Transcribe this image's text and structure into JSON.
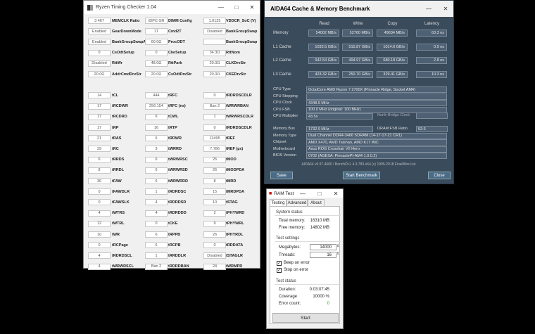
{
  "rtc": {
    "title": "Ryzen Timing Checker 1.04",
    "rows": [
      [
        "3 467",
        "MEMCLK Ratio",
        "tDPC-SR",
        "DIMM Config",
        "1.0125",
        "VDDCR_SoC (V)"
      ],
      [
        "Enabled",
        "GearDownMode",
        "1T",
        "Cmd2T",
        "Disabled",
        "BankGroupSwap"
      ],
      [
        "Enabled",
        "BankGroupSwapAlt",
        "60.0Ω",
        "ProcODT",
        "",
        "BankGroupSwap"
      ],
      [
        "0",
        "CsOdtSetup",
        "0",
        "CkeSetup",
        "34.3Ω",
        "RttNom"
      ],
      [
        "Disabled",
        "RttWr",
        "48.0Ω",
        "RttPark",
        "20.0Ω",
        "CLKDrvStr"
      ],
      [
        "20.0Ω",
        "AddrCmdDrvStr",
        "20.0Ω",
        "CsOdtDrvStr",
        "20.0Ω",
        "CKEDrvStr"
      ],
      [
        "",
        "",
        "",
        "",
        "",
        ""
      ],
      [
        "14",
        "tCL",
        "444",
        "tRFC",
        "0",
        "tRDRDSCDLR"
      ],
      [
        "17",
        "tRCDWR",
        "256.154",
        "tRFC (ns)",
        "Ban 2",
        "tWRWRBAN"
      ],
      [
        "17",
        "tRCDRD",
        "6",
        "tCWL",
        "1",
        "tWRWRSCDLR"
      ],
      [
        "17",
        "tRP",
        "16",
        "tRTP",
        "0",
        "tRDRDSCDLR"
      ],
      [
        "21",
        "tRAS",
        "6",
        "tRDWR",
        "13495",
        "tREF"
      ],
      [
        "29",
        "tRC",
        "3",
        "tWRRD",
        "7.786",
        "tREF (µs)"
      ],
      [
        "6",
        "tRRDS",
        "6",
        "tWRWRSC",
        "26",
        "tMOD"
      ],
      [
        "8",
        "tRRDL",
        "6",
        "tWRWRSD",
        "26",
        "tMODPDA"
      ],
      [
        "36",
        "tFAW",
        "6",
        "tWRWRDD",
        "8",
        "tMRD"
      ],
      [
        "0",
        "tFAWDLR",
        "1",
        "tRDRDSC",
        "15",
        "tMRDPDA"
      ],
      [
        "0",
        "tFAWSLK",
        "4",
        "tRDRDSD",
        "10",
        "tSTAG"
      ],
      [
        "4",
        "tWTRS",
        "4",
        "tRDRDDD",
        "2",
        "tPHYWRD"
      ],
      [
        "12",
        "tWTRL",
        "0",
        "tCKE",
        "9",
        "tPHYWRL"
      ],
      [
        "10",
        "tWR",
        "6",
        "tRPPB",
        "26",
        "tPHYRDL"
      ],
      [
        "0",
        "tRCPage",
        "6",
        "tRCPB",
        "0",
        "tRDDATA"
      ],
      [
        "4",
        "tRDRDSCL",
        "1",
        "tRRDDLR",
        "Disabled",
        "tSTAGLR"
      ],
      [
        "4",
        "tWRWRSCL",
        "Ban 2",
        "tRDRDBAN",
        "24",
        "tWRMPR"
      ]
    ]
  },
  "aida": {
    "title": "AIDA64 Cache & Memory Benchmark",
    "headers": [
      "Read",
      "Write",
      "Copy",
      "Latency"
    ],
    "bench": [
      {
        "label": "Memory",
        "vals": [
          "54002 MB/s",
          "52700 MB/s",
          "49634 MB/s",
          "63.3 ns"
        ]
      },
      {
        "label": "L1 Cache",
        "vals": [
          "1032.5 GB/s",
          "515.87 GB/s",
          "1014.6 GB/s",
          "0.9 ns"
        ]
      },
      {
        "label": "L2 Cache",
        "vals": [
          "942.54 GB/s",
          "494.97 GB/s",
          "680.18 GB/s",
          "2.8 ns"
        ]
      },
      {
        "label": "L3 Cache",
        "vals": [
          "423.32 GB/s",
          "250.70 GB/s",
          "329.41 GB/s",
          "10.3 ns"
        ]
      }
    ],
    "cpu_info": [
      {
        "label": "CPU Type",
        "val": "OctalCore AMD Ryzen 7 2700X  (Pinnacle Ridge, Socket AM4)"
      },
      {
        "label": "CPU Stepping",
        "val": ""
      },
      {
        "label": "CPU Clock",
        "val": "4348.9 MHz"
      },
      {
        "label": "CPU FSB",
        "val": "100.0 MHz  (original: 100 MHz)"
      },
      {
        "label": "CPU Multiplier",
        "val": "43.5x"
      }
    ],
    "nb_clock_label": "North Bridge Clock",
    "mem_info": [
      {
        "label": "Memory Bus",
        "val": "1732.9 MHz"
      },
      {
        "label": "Memory Type",
        "val": "Dual Channel DDR4-3466 SDRAM  (14-17-17-21 CR1)"
      },
      {
        "label": "Chipset",
        "val": "AMD X470, AMD Taishan, AMD K17 IMC"
      },
      {
        "label": "Motherboard",
        "val": "Asus ROG Crosshair VII Hero"
      },
      {
        "label": "BIOS Version",
        "val": "0702  (AGESA: PinnaclePI-AM4 1.0.0.2)"
      }
    ],
    "dram_ratio_label": "DRAM:FSB Ratio",
    "dram_ratio_val": "52:3",
    "footer": "AIDA64 v5.97.4600 / BenchDLL 4.3.783-x64  (c) 1995-2018 FinalWire Ltd.",
    "buttons": {
      "save": "Save",
      "start": "Start Benchmark",
      "close": "Close"
    }
  },
  "ram": {
    "title": "RAM Test",
    "tabs": [
      "Testing",
      "Advanced",
      "About"
    ],
    "system_status_label": "System status",
    "total_memory_label": "Total memory:",
    "total_memory": "16310 MB",
    "free_memory_label": "Free memory:",
    "free_memory": "14802 MB",
    "test_settings_label": "Test settings",
    "megabytes_label": "Megabytes:",
    "megabytes": "14000",
    "threads_label": "Threads:",
    "threads": "16",
    "beep_label": "Beep on error",
    "stop_label": "Stop on error",
    "test_status_label": "Test status",
    "duration_label": "Duration:",
    "duration": "0:03:07:45",
    "coverage_label": "Coverage",
    "coverage": "10000 %",
    "error_count_label": "Error count:",
    "error_count": "0",
    "start_label": "Start"
  },
  "colors": {
    "aida_bg": "#3a4b5c",
    "error_count": "#2e8b2e",
    "accent": "#4a6a86"
  }
}
